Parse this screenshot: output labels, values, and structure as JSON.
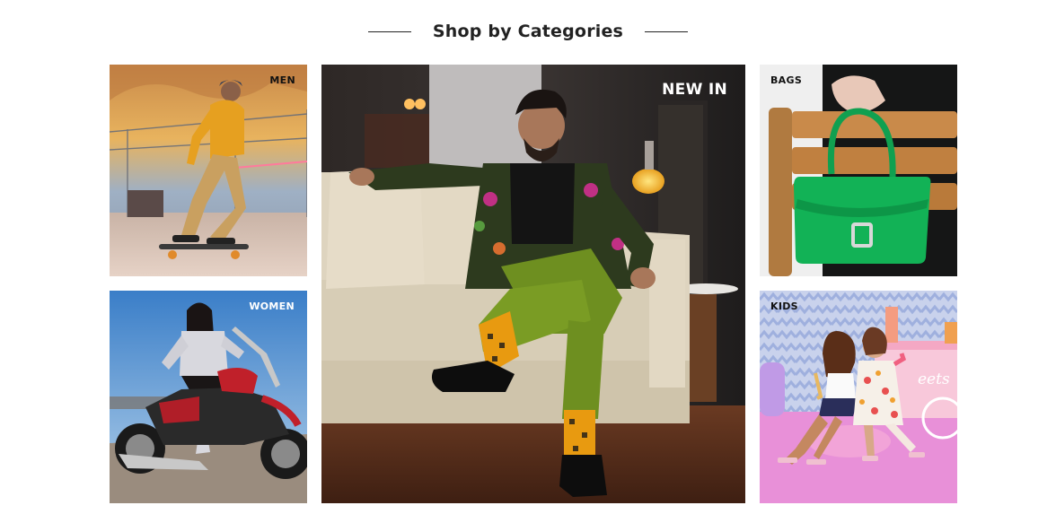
{
  "section": {
    "title": "Shop by Categories"
  },
  "categories": {
    "men": {
      "label": "MEN"
    },
    "newin": {
      "label": "NEW IN"
    },
    "bags": {
      "label": "BAGS"
    },
    "women": {
      "label": "WOMEN"
    },
    "kids": {
      "label": "KIDS"
    }
  },
  "colors": {
    "heading": "#222222",
    "divider": "#222222",
    "label_light": "#ffffff",
    "label_dark": "#111111"
  }
}
